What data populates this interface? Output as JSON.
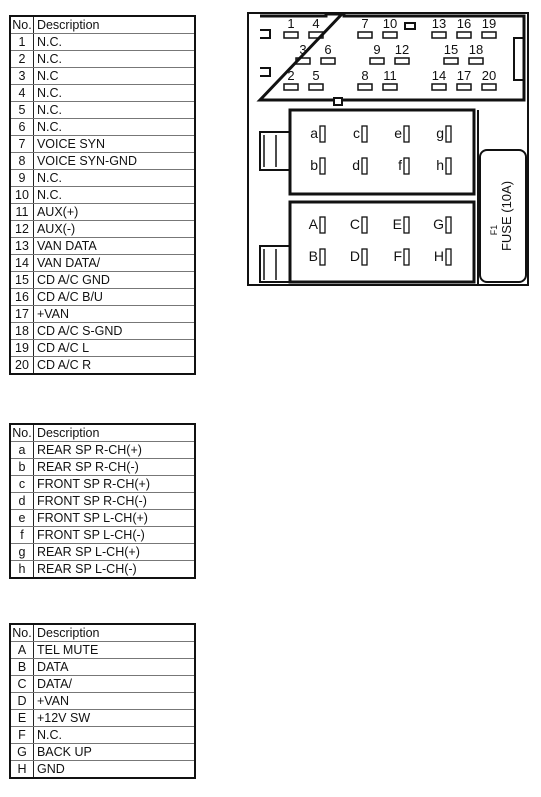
{
  "tables": {
    "main": {
      "header": {
        "no": "No.",
        "description": "Description"
      },
      "rows": [
        {
          "no": "1",
          "description": "N.C."
        },
        {
          "no": "2",
          "description": "N.C."
        },
        {
          "no": "3",
          "description": "N.C"
        },
        {
          "no": "4",
          "description": "N.C."
        },
        {
          "no": "5",
          "description": "N.C."
        },
        {
          "no": "6",
          "description": "N.C."
        },
        {
          "no": "7",
          "description": "VOICE SYN"
        },
        {
          "no": "8",
          "description": "VOICE SYN-GND"
        },
        {
          "no": "9",
          "description": "N.C."
        },
        {
          "no": "10",
          "description": "N.C."
        },
        {
          "no": "11",
          "description": "AUX(+)"
        },
        {
          "no": "12",
          "description": "AUX(-)"
        },
        {
          "no": "13",
          "description": "VAN DATA"
        },
        {
          "no": "14",
          "description": "VAN DATA/"
        },
        {
          "no": "15",
          "description": "CD A/C GND"
        },
        {
          "no": "16",
          "description": "CD A/C B/U"
        },
        {
          "no": "17",
          "description": "+VAN"
        },
        {
          "no": "18",
          "description": "CD A/C S-GND"
        },
        {
          "no": "19",
          "description": "CD A/C L"
        },
        {
          "no": "20",
          "description": "CD A/C R"
        }
      ]
    },
    "speaker": {
      "header": {
        "no": "No.",
        "description": "Description"
      },
      "rows": [
        {
          "no": "a",
          "description": "REAR SP R-CH(+)"
        },
        {
          "no": "b",
          "description": "REAR SP R-CH(-)"
        },
        {
          "no": "c",
          "description": "FRONT SP R-CH(+)"
        },
        {
          "no": "d",
          "description": "FRONT SP R-CH(-)"
        },
        {
          "no": "e",
          "description": "FRONT SP L-CH(+)"
        },
        {
          "no": "f",
          "description": "FRONT SP L-CH(-)"
        },
        {
          "no": "g",
          "description": "REAR SP L-CH(+)"
        },
        {
          "no": "h",
          "description": "REAR SP L-CH(-)"
        }
      ]
    },
    "power": {
      "header": {
        "no": "No.",
        "description": "Description"
      },
      "rows": [
        {
          "no": "A",
          "description": "TEL MUTE"
        },
        {
          "no": "B",
          "description": "DATA"
        },
        {
          "no": "C",
          "description": "DATA/"
        },
        {
          "no": "D",
          "description": "+VAN"
        },
        {
          "no": "E",
          "description": "+12V SW"
        },
        {
          "no": "F",
          "description": "N.C."
        },
        {
          "no": "G",
          "description": "BACK UP"
        },
        {
          "no": "H",
          "description": "GND"
        }
      ]
    }
  },
  "connector": {
    "top_block_pins": {
      "row1": [
        "1",
        "4",
        "7",
        "10",
        "13",
        "16",
        "19"
      ],
      "row2": [
        "3",
        "6",
        "9",
        "12",
        "15",
        "18"
      ],
      "row3": [
        "2",
        "5",
        "8",
        "11",
        "14",
        "17",
        "20"
      ]
    },
    "speaker_block_pins": {
      "row1": [
        "a",
        "c",
        "e",
        "g"
      ],
      "row2": [
        "b",
        "d",
        "f",
        "h"
      ]
    },
    "power_block_pins": {
      "row1": [
        "A",
        "C",
        "E",
        "G"
      ],
      "row2": [
        "B",
        "D",
        "F",
        "H"
      ]
    },
    "fuse": {
      "ref": "F1",
      "label": "FUSE (10A)"
    }
  }
}
